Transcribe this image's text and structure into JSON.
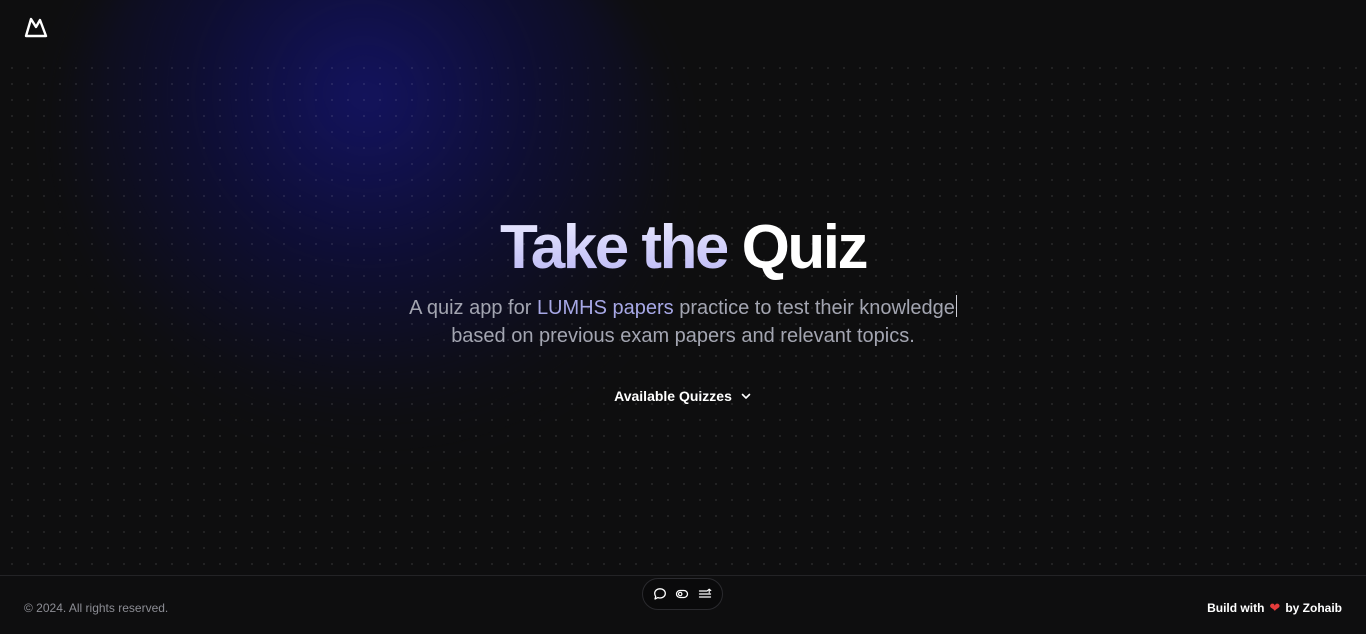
{
  "header": {
    "logo_icon": "mountain-logo-icon"
  },
  "hero": {
    "title_part1": "Take the",
    "title_part2": "Quiz",
    "subtitle_before": "A quiz app for ",
    "subtitle_highlight": "LUMHS papers",
    "subtitle_after_line1": " practice to test their knowledge",
    "subtitle_line2": "based on previous exam papers and relevant topics.",
    "quizzes_button_label": "Available Quizzes",
    "quizzes_button_icon": "chevron-down-icon"
  },
  "dock": {
    "items": [
      {
        "icon": "chat-bubble-icon"
      },
      {
        "icon": "toggle-icon"
      },
      {
        "icon": "menu-list-icon"
      }
    ]
  },
  "footer": {
    "copyright": "© 2024. All rights reserved.",
    "built_prefix": "Build with",
    "built_icon": "heart-icon",
    "built_suffix": "by Zohaib"
  },
  "colors": {
    "background": "#0e0e0f",
    "glow": "#14146e",
    "accent_text": "#a7a8e6",
    "heart": "#e53b3b"
  }
}
